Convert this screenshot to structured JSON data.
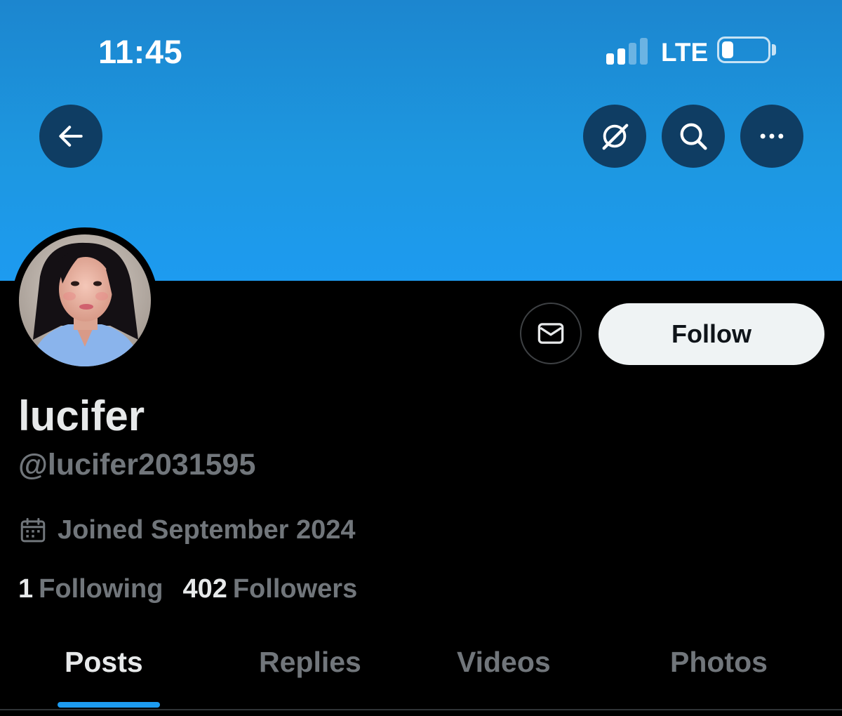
{
  "status_bar": {
    "time": "11:45",
    "network": "LTE",
    "signal_bars_active": 2,
    "signal_bars_total": 4,
    "battery_level": 0.25,
    "battery_icon": "battery-icon"
  },
  "header": {
    "back_icon": "arrow-left-icon",
    "grok_icon": "grok-icon",
    "search_icon": "search-icon",
    "more_icon": "more-horizontal-icon"
  },
  "profile": {
    "display_name": "lucifer",
    "handle": "@lucifer2031595",
    "joined": "Joined September 2024",
    "following_count": "1",
    "following_label": "Following",
    "followers_count": "402",
    "followers_label": "Followers",
    "avatar_alt": "avatar"
  },
  "actions": {
    "message_icon": "envelope-icon",
    "follow_label": "Follow"
  },
  "tabs": [
    {
      "label": "Posts",
      "active": true
    },
    {
      "label": "Replies",
      "active": false
    },
    {
      "label": "Videos",
      "active": false
    },
    {
      "label": "Photos",
      "active": false
    }
  ],
  "colors": {
    "banner": "#1d9bf0",
    "accent": "#1d9bf0",
    "text_primary": "#e7e9ea",
    "text_secondary": "#71767b",
    "follow_bg": "#eff3f4",
    "nav_button_bg": "#0f3d63"
  }
}
